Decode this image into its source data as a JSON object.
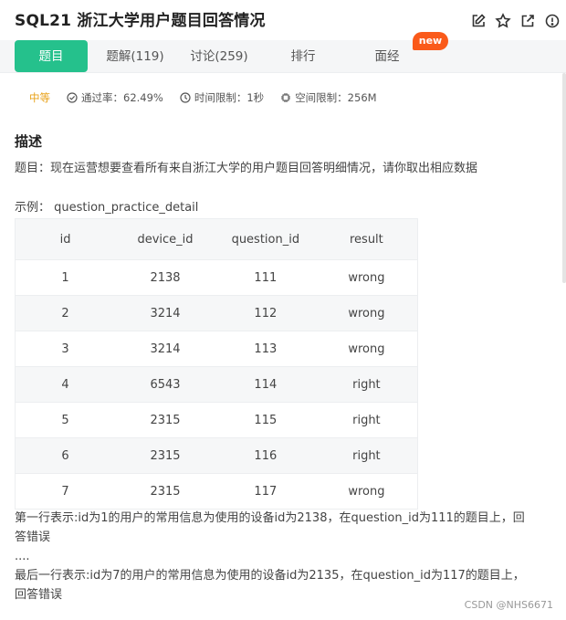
{
  "header": {
    "title": "SQL21  浙江大学用户题目回答情况",
    "icons": [
      "edit-icon",
      "star-icon",
      "share-icon",
      "report-icon"
    ]
  },
  "tabs": [
    {
      "label": "题目"
    },
    {
      "label": "题解(119)"
    },
    {
      "label": "讨论(259)"
    },
    {
      "label": "排行"
    },
    {
      "label": "面经"
    }
  ],
  "new_badge": "new",
  "meta": {
    "level": "中等",
    "pass_rate": "通过率：62.49%",
    "time_limit": "时间限制：1秒",
    "space_limit": "空间限制：256M"
  },
  "description": {
    "heading": "描述",
    "text": "题目：现在运营想要查看所有来自浙江大学的用户题目回答明细情况，请你取出相应数据",
    "example_label": "示例： question_practice_detail"
  },
  "table": {
    "headers": [
      "id",
      "device_id",
      "question_id",
      "result"
    ],
    "rows": [
      [
        "1",
        "2138",
        "111",
        "wrong"
      ],
      [
        "2",
        "3214",
        "112",
        "wrong"
      ],
      [
        "3",
        "3214",
        "113",
        "wrong"
      ],
      [
        "4",
        "6543",
        "114",
        "right"
      ],
      [
        "5",
        "2315",
        "115",
        "right"
      ],
      [
        "6",
        "2315",
        "116",
        "right"
      ],
      [
        "7",
        "2315",
        "117",
        "wrong"
      ]
    ]
  },
  "notes": {
    "first_line_a": "第一行表示:id为1的用户的常用信息为使用的设备id为2138，在question_id为111的题目上，回",
    "first_line_b": "答错误",
    "ellipsis": "....",
    "last_line_a": "最后一行表示:id为7的用户的常用信息为使用的设备id为2135，在question_id为117的题目上，",
    "last_line_b": "回答错误"
  },
  "watermark": "CSDN @NHS6671",
  "colors": {
    "accent": "#25c18c",
    "badge": "#fa5a1a",
    "level": "#e8a21a"
  }
}
